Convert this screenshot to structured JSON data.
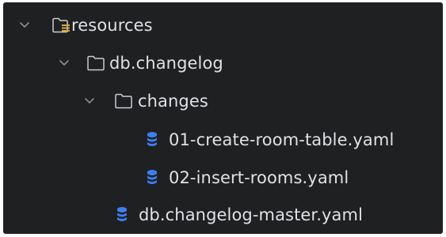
{
  "tree": {
    "items": [
      {
        "label": "resources",
        "kind": "folder-resources",
        "expanded": true,
        "level": 0
      },
      {
        "label": "db.changelog",
        "kind": "folder",
        "expanded": true,
        "level": 1
      },
      {
        "label": "changes",
        "kind": "folder",
        "expanded": true,
        "level": 2
      },
      {
        "label": "01-create-room-table.yaml",
        "kind": "yaml-db-file",
        "level": 3
      },
      {
        "label": "02-insert-rooms.yaml",
        "kind": "yaml-db-file",
        "level": 3
      },
      {
        "label": "db.changelog-master.yaml",
        "kind": "yaml-db-file",
        "level": 2
      }
    ]
  },
  "colors": {
    "background": "#1f2022",
    "text": "#dfe1e5",
    "folder_outline": "#c9ccd1",
    "chevron": "#8b8e94",
    "resources_marker": "#d9a83c",
    "db_icon": "#3d7ff0"
  }
}
